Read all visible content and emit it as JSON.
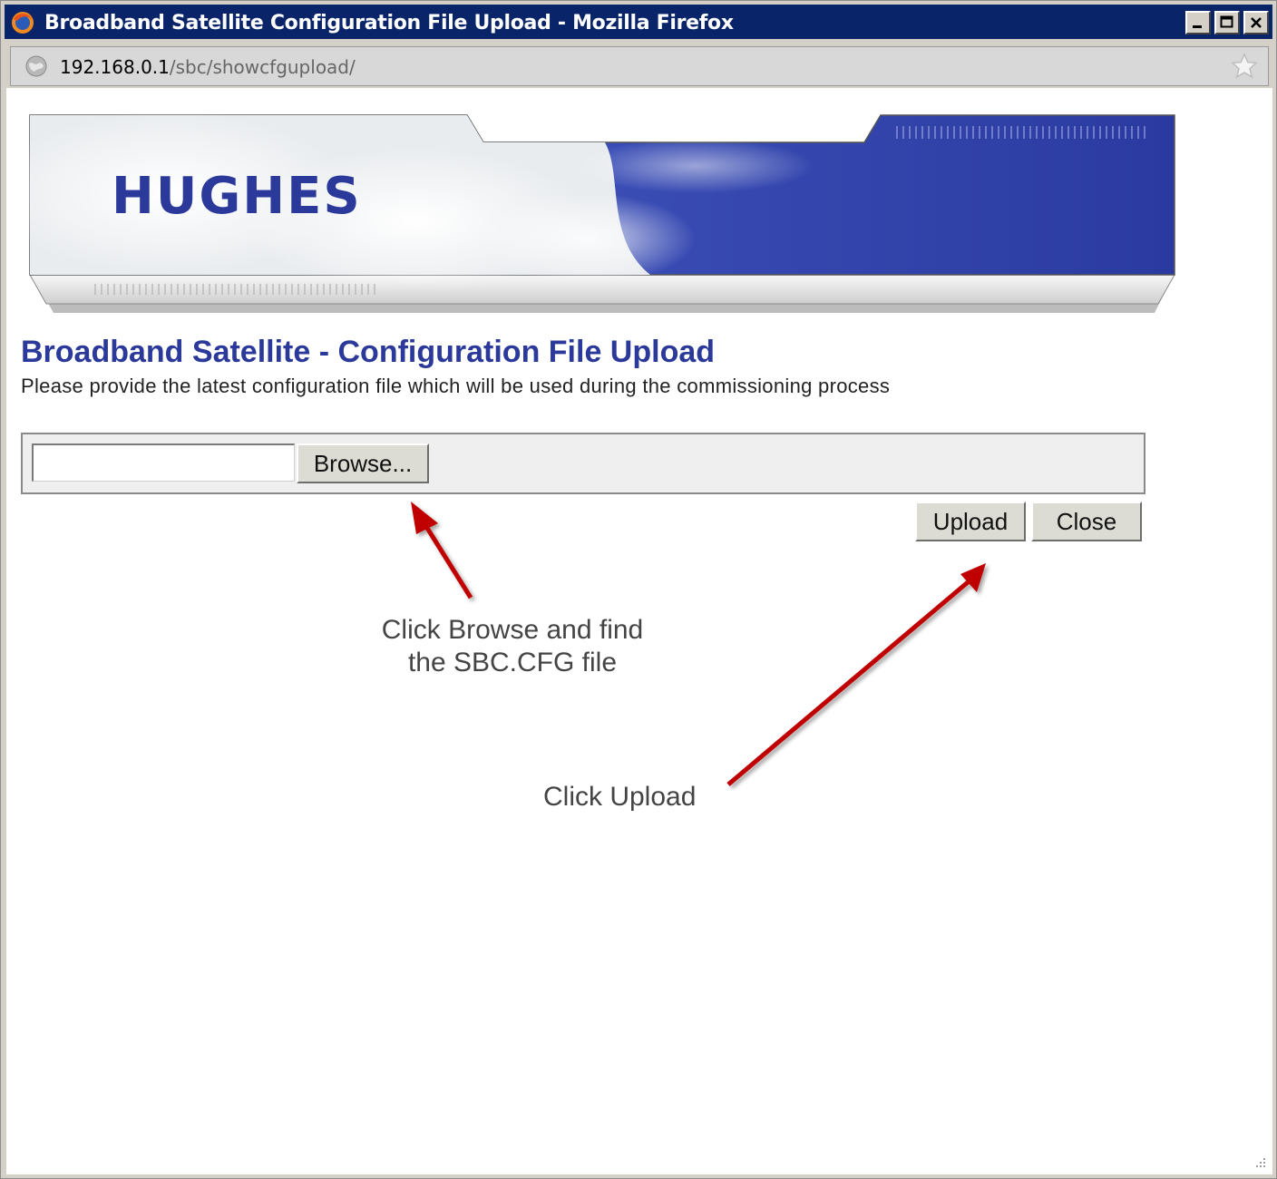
{
  "window": {
    "title": "Broadband Satellite Configuration File Upload - Mozilla Firefox",
    "controls": {
      "minimize": "_",
      "maximize": "□",
      "close": "✕"
    }
  },
  "address_bar": {
    "host": "192.168.0.1",
    "path": "/sbc/showcfgupload/",
    "icons": {
      "site": "globe-icon",
      "bookmark": "star-icon"
    }
  },
  "banner": {
    "logo_text": "HUGHES"
  },
  "page": {
    "title": "Broadband Satellite - Configuration File Upload",
    "subtitle": "Please provide the latest configuration file which will be used during the commissioning process"
  },
  "form": {
    "file_value": "",
    "browse_label": "Browse...",
    "upload_label": "Upload",
    "close_label": "Close"
  },
  "annotations": {
    "browse_note_line1": "Click Browse and find",
    "browse_note_line2": "the SBC.CFG file",
    "upload_note": "Click Upload"
  },
  "colors": {
    "title_bar": "#0a246a",
    "page_title": "#2b3a9a",
    "arrow": "#c00000"
  }
}
